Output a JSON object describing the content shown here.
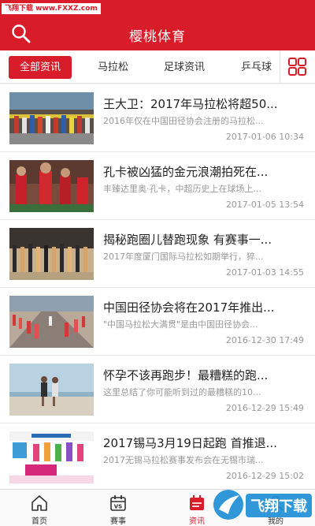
{
  "watermark": "飞翔下载 www.FXXZ.com",
  "header": {
    "title": "樱桃体育"
  },
  "tabs": [
    {
      "label": "全部资讯",
      "active": true
    },
    {
      "label": "马拉松",
      "active": false
    },
    {
      "label": "足球资讯",
      "active": false
    },
    {
      "label": "乒乓球",
      "active": false
    }
  ],
  "news": [
    {
      "title": "王大卫：2017年马拉松将超50...",
      "desc": "2016年仅在中国田径协会注册的马拉松...",
      "date": "2017-01-06 10:34"
    },
    {
      "title": "孔卡被凶猛的金元浪潮拍死在...",
      "desc": "丰臻达里奥·孔卡，中超历史上在球场上...",
      "date": "2017-01-05 13:54"
    },
    {
      "title": "揭秘跑圈儿替跑现象 有赛事一...",
      "desc": "2017年度厦门国际马拉松如期举行，猝...",
      "date": "2017-01-03 14:55"
    },
    {
      "title": "中国田径协会将在2017年推出...",
      "desc": "\"中国马拉松大满贯\"是由中国田径协会...",
      "date": "2016-12-30 17:49"
    },
    {
      "title": "怀孕不该再跑步！最糟糕的跑...",
      "desc": "这里总结了你可能听到过的最糟糕的10...",
      "date": "2016-12-29 15:49"
    },
    {
      "title": "2017锡马3月19日起跑 首推退...",
      "desc": "2017无锡马拉松赛事发布会在无锡市瑞...",
      "date": "2016-12-29 15:02"
    }
  ],
  "nav": [
    {
      "label": "首页",
      "icon": "home-icon",
      "active": false
    },
    {
      "label": "赛事",
      "icon": "calendar-vs-icon",
      "active": false
    },
    {
      "label": "资讯",
      "icon": "news-calendar-icon",
      "active": true
    },
    {
      "label": "我的",
      "icon": "user-icon",
      "active": false
    }
  ],
  "logo_overlay_text": "飞翔下载",
  "colors": {
    "brand": "#d81c2a",
    "text": "#222222",
    "muted": "#999999"
  }
}
